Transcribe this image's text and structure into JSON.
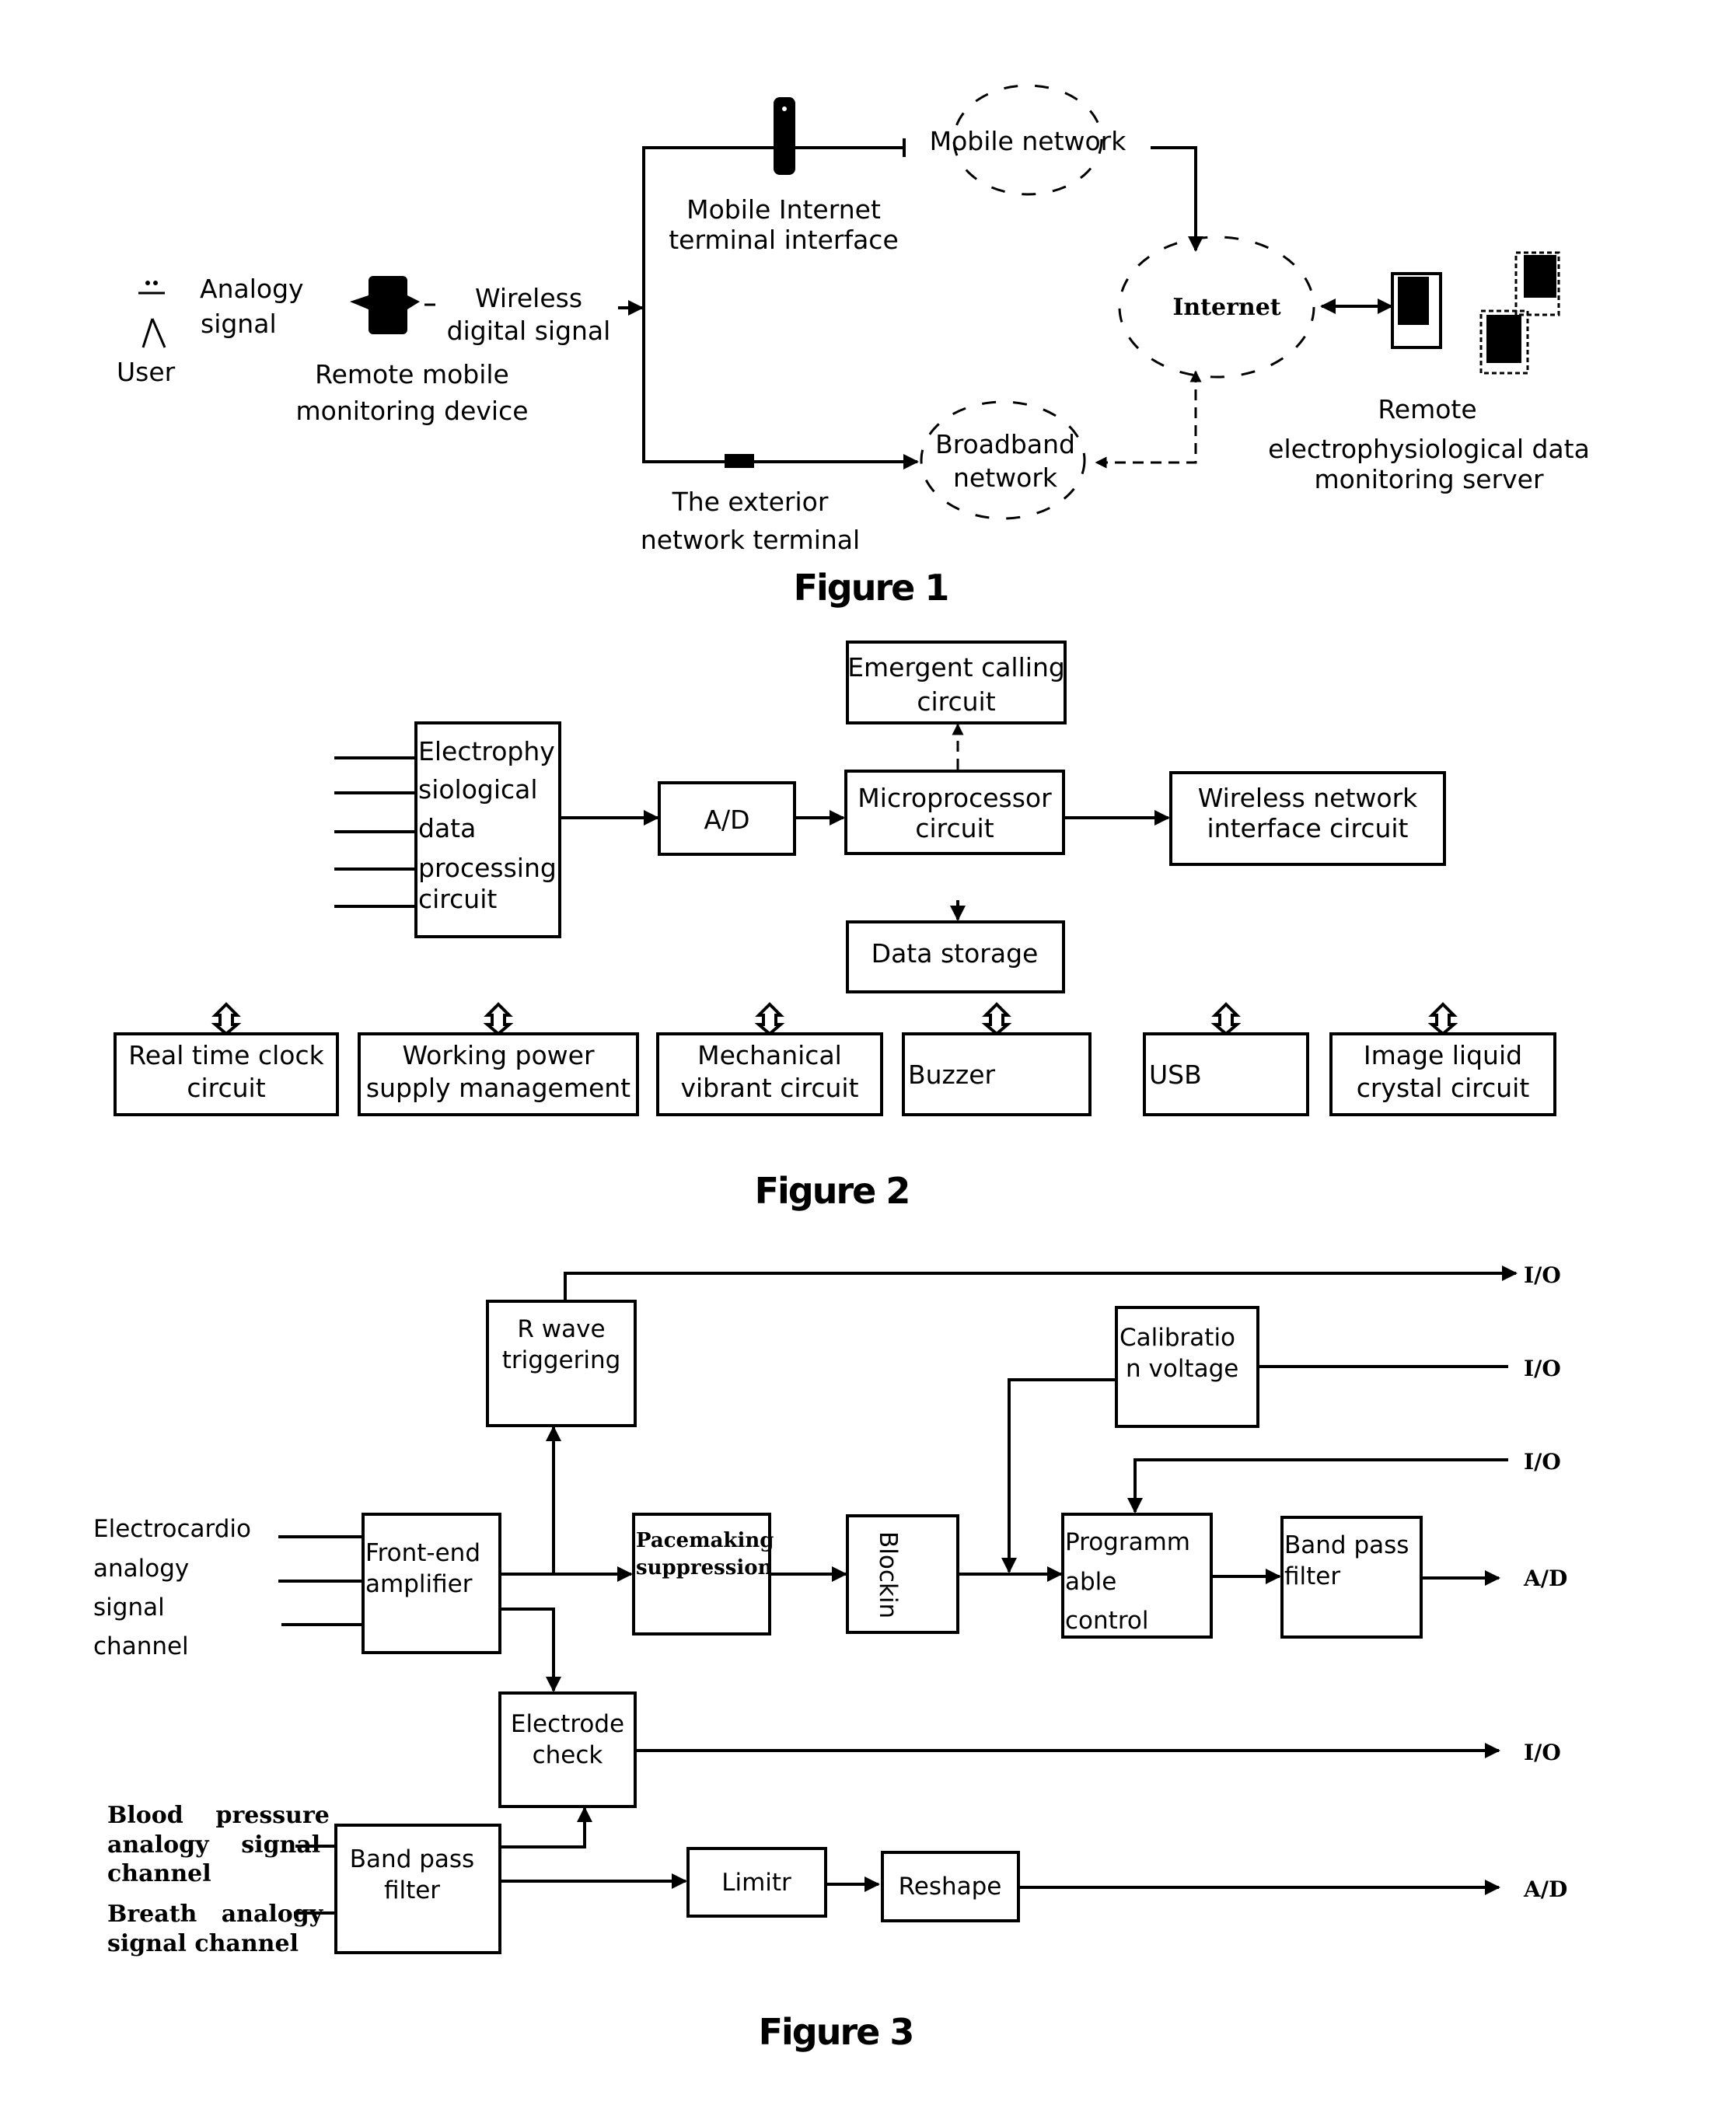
{
  "figure1": {
    "caption": "Figure 1",
    "user_label": "User",
    "analogy_signal": [
      "Analogy",
      "signal"
    ],
    "remote_device": [
      "Remote mobile",
      "monitoring device"
    ],
    "wireless_signal": [
      "Wireless",
      "digital signal"
    ],
    "mobile_terminal": [
      "Mobile Internet",
      "terminal interface"
    ],
    "exterior_terminal": [
      "The exterior",
      "network terminal"
    ],
    "mobile_network": "Mobile network",
    "broadband_network": [
      "Broadband",
      "network"
    ],
    "internet": "Internet",
    "server": [
      "Remote",
      "electrophysiological data",
      "monitoring server"
    ]
  },
  "figure2": {
    "caption": "Figure 2",
    "electrophysiological_box": [
      "Electrophy",
      "siological",
      "data",
      "processing",
      "circuit"
    ],
    "ad_box": "A/D",
    "microprocessor_box": [
      "Microprocessor",
      "circuit"
    ],
    "emergent_box": [
      "Emergent calling",
      "circuit"
    ],
    "wireless_box": [
      "Wireless network",
      "interface circuit"
    ],
    "storage_box": "Data storage",
    "peripherals": [
      {
        "lines": [
          "Real time clock",
          "circuit"
        ]
      },
      {
        "lines": [
          "Working power",
          "supply management"
        ]
      },
      {
        "lines": [
          "Mechanical",
          "vibrant circuit"
        ]
      },
      {
        "lines": [
          "Buzzer"
        ]
      },
      {
        "lines": [
          "USB"
        ]
      },
      {
        "lines": [
          "Image liquid",
          "crystal circuit"
        ]
      }
    ]
  },
  "figure3": {
    "caption": "Figure 3",
    "ecg_input": [
      "Electrocardio",
      "analogy",
      "signal",
      "channel"
    ],
    "bp_input": [
      "Blood    pressure",
      "analogy    signal",
      "channel"
    ],
    "breath_input": [
      "Breath   analogy",
      "signal channel"
    ],
    "rwave_box": [
      "R wave",
      "triggering"
    ],
    "frontend_box": [
      "Front-end",
      "amplifier"
    ],
    "pacemaking_box": [
      "Pacemaking",
      "suppression"
    ],
    "blockin_box": "Blockin",
    "calibration_box": [
      "Calibratio",
      "n voltage"
    ],
    "programmable_box": [
      "Programm",
      "able",
      "control"
    ],
    "bandpass1_box": [
      "Band pass",
      "filter"
    ],
    "electrode_box": [
      "Electrode",
      "check"
    ],
    "bandpass2_box": [
      "Band pass",
      "filter"
    ],
    "limiter_box": "Limitr",
    "reshape_box": "Reshape",
    "outputs": [
      "I/O",
      "I/O",
      "I/O",
      "A/D",
      "I/O",
      "A/D"
    ]
  }
}
